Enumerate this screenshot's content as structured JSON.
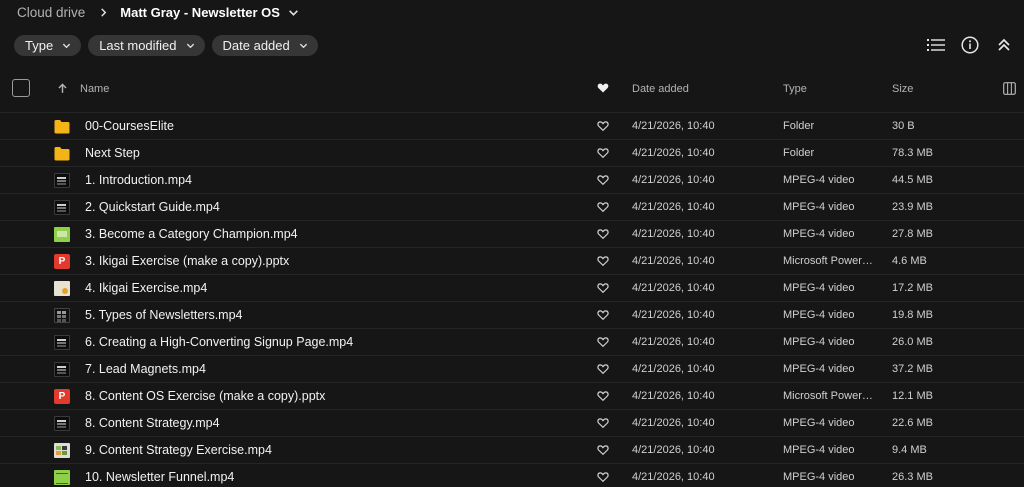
{
  "breadcrumb": {
    "root": "Cloud drive",
    "current": "Matt Gray - Newsletter OS"
  },
  "filters": [
    {
      "label": "Type"
    },
    {
      "label": "Last modified"
    },
    {
      "label": "Date added"
    }
  ],
  "toolbar": {
    "list_view_icon": "list-view-icon",
    "info_icon": "info-icon",
    "collapse_icon": "double-chevron-up-icon"
  },
  "columns": {
    "name": "Name",
    "date_added": "Date added",
    "type": "Type",
    "size": "Size"
  },
  "rows": [
    {
      "name": "00-CoursesElite",
      "date": "4/21/2026, 10:40",
      "type": "Folder",
      "size": "30 B",
      "icon": "folder"
    },
    {
      "name": "Next Step",
      "date": "4/21/2026, 10:40",
      "type": "Folder",
      "size": "78.3 MB",
      "icon": "folder"
    },
    {
      "name": "1. Introduction.mp4",
      "date": "4/21/2026, 10:40",
      "type": "MPEG-4 video",
      "size": "44.5 MB",
      "icon": "video"
    },
    {
      "name": "2. Quickstart Guide.mp4",
      "date": "4/21/2026, 10:40",
      "type": "MPEG-4 video",
      "size": "23.9 MB",
      "icon": "video"
    },
    {
      "name": "3. Become a Category Champion.mp4",
      "date": "4/21/2026, 10:40",
      "type": "MPEG-4 video",
      "size": "27.8 MB",
      "icon": "green"
    },
    {
      "name": "3. Ikigai Exercise (make a copy).pptx",
      "date": "4/21/2026, 10:40",
      "type": "Microsoft PowerPoint presentation",
      "size": "4.6 MB",
      "icon": "ppt"
    },
    {
      "name": "4. Ikigai Exercise.mp4",
      "date": "4/21/2026, 10:40",
      "type": "MPEG-4 video",
      "size": "17.2 MB",
      "icon": "light"
    },
    {
      "name": "5. Types of Newsletters.mp4",
      "date": "4/21/2026, 10:40",
      "type": "MPEG-4 video",
      "size": "19.8 MB",
      "icon": "grid"
    },
    {
      "name": "6. Creating a High-Converting Signup Page.mp4",
      "date": "4/21/2026, 10:40",
      "type": "MPEG-4 video",
      "size": "26.0 MB",
      "icon": "video"
    },
    {
      "name": "7. Lead Magnets.mp4",
      "date": "4/21/2026, 10:40",
      "type": "MPEG-4 video",
      "size": "37.2 MB",
      "icon": "video"
    },
    {
      "name": "8. Content OS Exercise (make a copy).pptx",
      "date": "4/21/2026, 10:40",
      "type": "Microsoft PowerPoint presentation",
      "size": "12.1 MB",
      "icon": "ppt"
    },
    {
      "name": "8. Content Strategy.mp4",
      "date": "4/21/2026, 10:40",
      "type": "MPEG-4 video",
      "size": "22.6 MB",
      "icon": "video"
    },
    {
      "name": "9. Content Strategy Exercise.mp4",
      "date": "4/21/2026, 10:40",
      "type": "MPEG-4 video",
      "size": "9.4 MB",
      "icon": "mixed"
    },
    {
      "name": "10. Newsletter Funnel.mp4",
      "date": "4/21/2026, 10:40",
      "type": "MPEG-4 video",
      "size": "26.3 MB",
      "icon": "table"
    }
  ],
  "colors": {
    "background": "#161616",
    "chip": "#363636",
    "folder": "#f5b416",
    "ppt": "#e23b2e"
  }
}
